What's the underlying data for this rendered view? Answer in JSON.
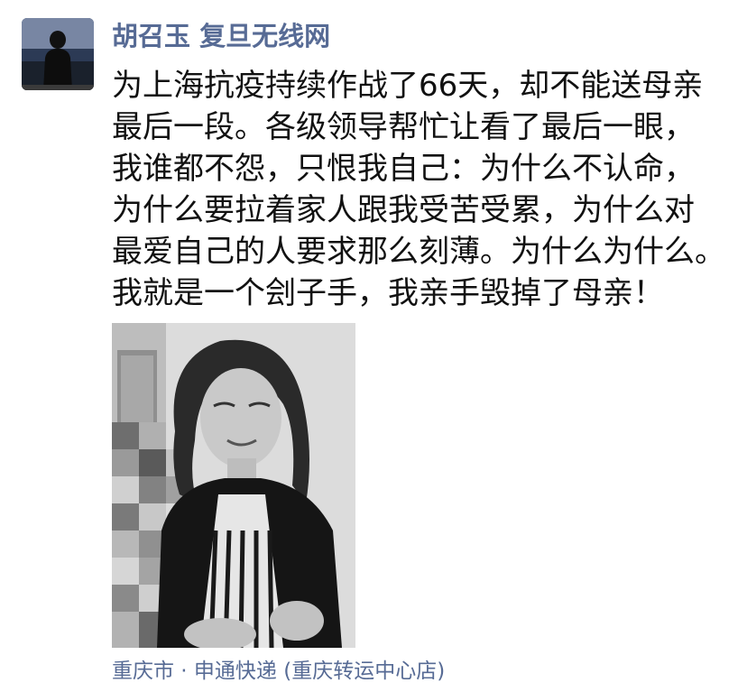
{
  "moment": {
    "author": "胡召玉 复旦无线网",
    "avatar_icon": "user-avatar-icon",
    "text_lines": [
      "为上海抗疫持续作战了66天，却不能送母亲",
      "最后一段。各级领导帮忙让看了最后一眼，",
      "我谁都不怨，只恨我自己：为什么不认命，",
      "为什么要拉着家人跟我受苦受累，为什么对",
      "最爱自己的人要求那么刻薄。为什么为什么。",
      "我就是一个刽子手，我亲手毁掉了母亲！"
    ],
    "photo_icon": "portrait-photo-icon",
    "location": "重庆市 · 申通快递 (重庆转运中心店)"
  },
  "colors": {
    "link": "#576b95",
    "text": "#111111",
    "background": "#ffffff"
  }
}
